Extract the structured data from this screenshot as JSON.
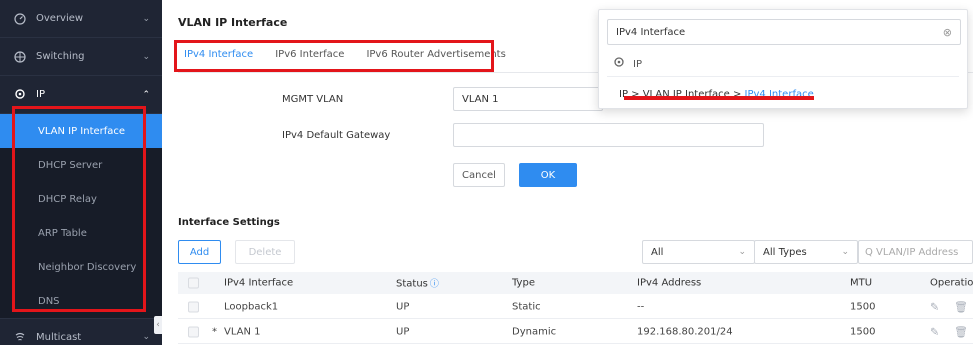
{
  "sidebar": {
    "sections": [
      {
        "label": "Overview",
        "icon": "overview-icon",
        "chevron": "⌄"
      },
      {
        "label": "Switching",
        "icon": "switching-icon",
        "chevron": "⌄"
      },
      {
        "label": "IP",
        "icon": "location-pin-icon",
        "chevron": "⌃"
      }
    ],
    "ip_items": [
      "VLAN IP Interface",
      "DHCP Server",
      "DHCP Relay",
      "ARP Table",
      "Neighbor Discovery",
      "DNS"
    ],
    "active_item": "VLAN IP Interface",
    "bottom_section": {
      "label": "Multicast",
      "icon": "multicast-icon",
      "chevron": "⌄"
    }
  },
  "page": {
    "title": "VLAN IP Interface",
    "tabs": [
      "IPv4 Interface",
      "IPv6 Interface",
      "IPv6 Router Advertisements"
    ],
    "active_tab": "IPv4 Interface"
  },
  "form": {
    "mgmt_vlan_label": "MGMT VLAN",
    "mgmt_vlan_value": "VLAN 1",
    "gateway_label": "IPv4 Default Gateway",
    "gateway_value": "",
    "cancel_label": "Cancel",
    "ok_label": "OK"
  },
  "interface_settings": {
    "title": "Interface Settings",
    "add_label": "Add",
    "delete_label": "Delete",
    "filter_all": "All",
    "filter_types": "All Types",
    "search_placeholder": "Q VLAN/IP Address",
    "columns": [
      "IPv4 Interface",
      "Status",
      "Type",
      "IPv4 Address",
      "MTU",
      "Operation"
    ],
    "rows": [
      {
        "marker": "",
        "name": "Loopback1",
        "status": "UP",
        "type": "Static",
        "address": "--",
        "mtu": "1500"
      },
      {
        "marker": "*",
        "name": "VLAN 1",
        "status": "UP",
        "type": "Dynamic",
        "address": "192.168.80.201/24",
        "mtu": "1500"
      }
    ]
  },
  "search_dropdown": {
    "query": "IPv4 Interface",
    "location": "IP",
    "path_prefix": "IP > VLAN IP Interface > ",
    "path_match": "IPv4 Interface"
  },
  "colors": {
    "accent": "#2f8cf0",
    "sidebar_bg": "#1f2534",
    "highlight_red": "#e3151a"
  }
}
